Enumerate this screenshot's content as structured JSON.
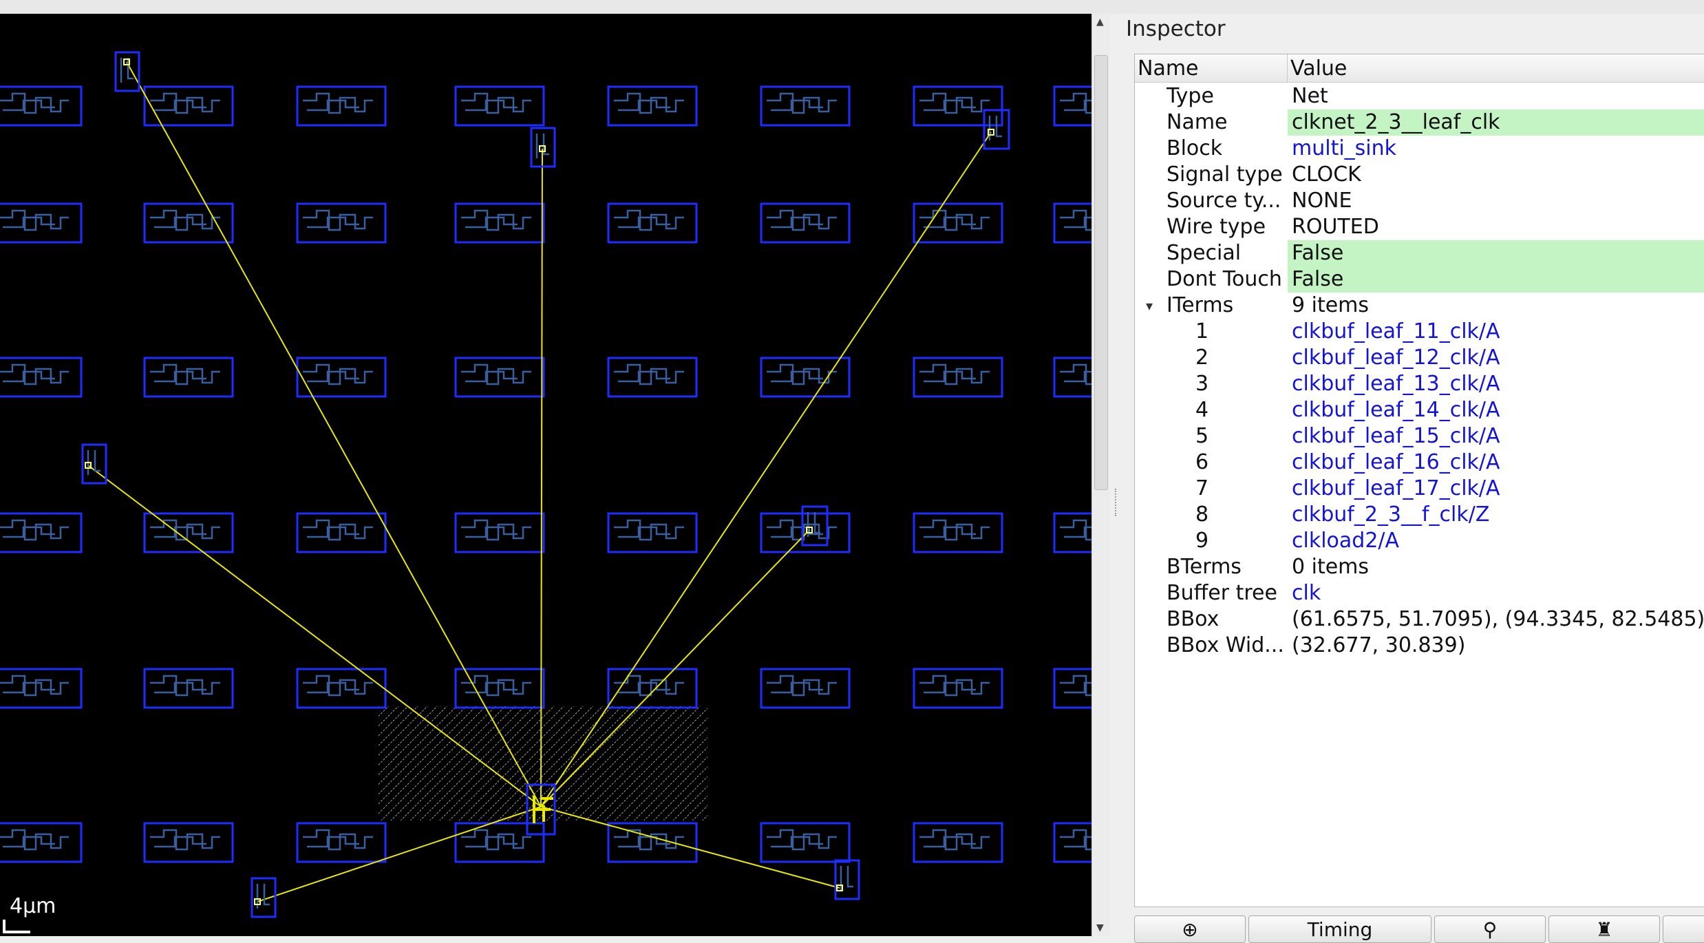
{
  "colors": {
    "layout_background": "#000000",
    "cell_outline": "#1f2bff",
    "cell_internal": "#3a5fa0",
    "net_flyline": "#e8e800",
    "pin": "#ffff66",
    "link_text": "#1414d8",
    "editable_highlight": "#c4f4c4"
  },
  "layout": {
    "scale_label": "4μm"
  },
  "inspector": {
    "title": "Inspector",
    "columns": {
      "name": "Name",
      "value": "Value"
    },
    "rows": [
      {
        "name": "Type",
        "value": "Net"
      },
      {
        "name": "Name",
        "value": "clknet_2_3__leaf_clk"
      },
      {
        "name": "Block",
        "value": "multi_sink"
      },
      {
        "name": "Signal type",
        "value": "CLOCK"
      },
      {
        "name": "Source ty...",
        "value": "NONE"
      },
      {
        "name": "Wire type",
        "value": "ROUTED"
      },
      {
        "name": "Special",
        "value": "False"
      },
      {
        "name": "Dont Touch",
        "value": "False"
      },
      {
        "name": "ITerms",
        "value": "9 items"
      },
      {
        "name": "1",
        "value": "clkbuf_leaf_11_clk/A"
      },
      {
        "name": "2",
        "value": "clkbuf_leaf_12_clk/A"
      },
      {
        "name": "3",
        "value": "clkbuf_leaf_13_clk/A"
      },
      {
        "name": "4",
        "value": "clkbuf_leaf_14_clk/A"
      },
      {
        "name": "5",
        "value": "clkbuf_leaf_15_clk/A"
      },
      {
        "name": "6",
        "value": "clkbuf_leaf_16_clk/A"
      },
      {
        "name": "7",
        "value": "clkbuf_leaf_17_clk/A"
      },
      {
        "name": "8",
        "value": "clkbuf_2_3__f_clk/Z"
      },
      {
        "name": "9",
        "value": "clkload2/A"
      },
      {
        "name": "BTerms",
        "value": "0 items"
      },
      {
        "name": "Buffer tree",
        "value": "clk"
      },
      {
        "name": "BBox",
        "value": "(61.6575, 51.7095), (94.3345, 82.5485)"
      },
      {
        "name": "BBox Wid...",
        "value": "(32.677, 30.839)"
      }
    ],
    "buttons": {
      "zoom_label": "⊕",
      "timing_label": "Timing",
      "inspect_label": "⚲",
      "highlight_label": "♜"
    }
  }
}
